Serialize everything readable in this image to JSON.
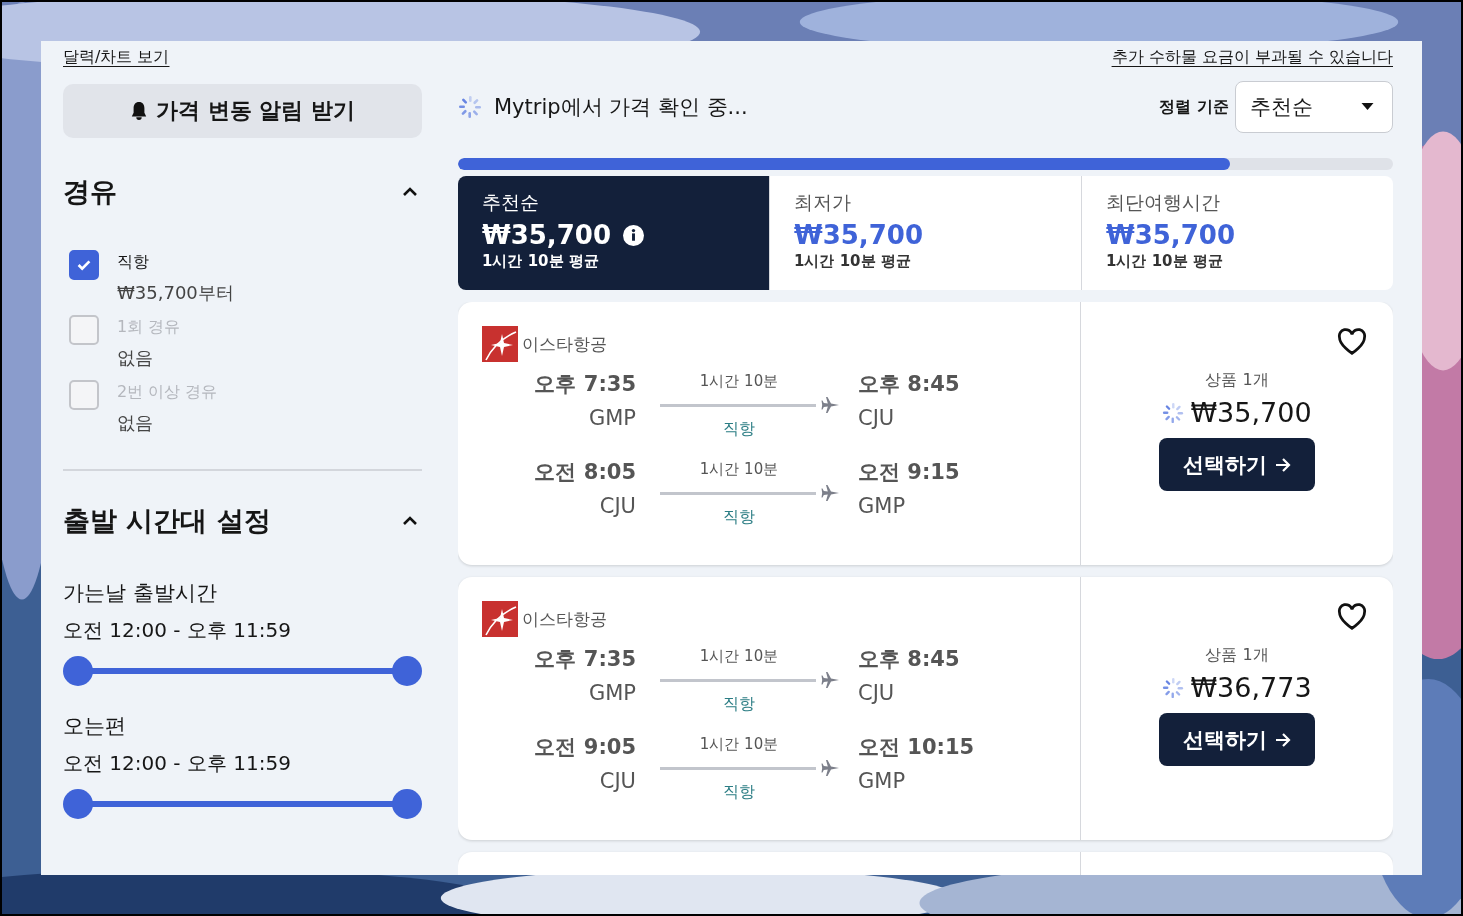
{
  "sidebar": {
    "calendar_link": "달력/차트 보기",
    "alert_button": "가격 변동 알림 받기",
    "stops": {
      "title": "경유",
      "expanded": true,
      "options": [
        {
          "label": "직항",
          "sub": "₩35,700부터",
          "checked": true,
          "disabled": false
        },
        {
          "label": "1회 경유",
          "sub": "없음",
          "checked": false,
          "disabled": true
        },
        {
          "label": "2번 이상 경유",
          "sub": "없음",
          "checked": false,
          "disabled": true
        }
      ]
    },
    "times": {
      "title": "출발 시간대 설정",
      "expanded": true,
      "ranges": [
        {
          "label": "가는날 출발시간",
          "value": "오전 12:00 - 오후 11:59",
          "thumbs": [
            {
              "level": 0
            },
            {
              "level": 1
            }
          ]
        },
        {
          "label": "오는편",
          "value": "오전 12:00 - 오후 11:59",
          "thumbs": [
            {
              "level": 0
            },
            {
              "level": 1
            }
          ]
        }
      ]
    }
  },
  "main": {
    "baggage_note": "추가 수하물 요금이 부과될 수 있습니다",
    "status": "Mytrip에서 가격 확인 중...",
    "sort": {
      "label": "정렬 기준",
      "value": "추천순"
    },
    "progress": {
      "level": 0.826
    },
    "sort_tabs": [
      {
        "label": "추천순",
        "price": "₩35,700",
        "duration": "1시간 10분 평균",
        "info": true,
        "selected": true
      },
      {
        "label": "최저가",
        "price": "₩35,700",
        "duration": "1시간 10분 평균",
        "info": false,
        "selected": false
      },
      {
        "label": "최단여행시간",
        "price": "₩35,700",
        "duration": "1시간 10분 평균",
        "info": false,
        "selected": false
      }
    ],
    "results": [
      {
        "airline": "이스타항공",
        "offers": "상품 1개",
        "price": "₩35,700",
        "button": "선택하기",
        "favorite": false,
        "legs": [
          {
            "dep_time": "오후 7:35",
            "dep": "GMP",
            "duration": "1시간 10분",
            "stops": "직항",
            "arr_time": "오후 8:45",
            "arr": "CJU"
          },
          {
            "dep_time": "오전 8:05",
            "dep": "CJU",
            "duration": "1시간 10분",
            "stops": "직항",
            "arr_time": "오전 9:15",
            "arr": "GMP"
          }
        ]
      },
      {
        "airline": "이스타항공",
        "offers": "상품 1개",
        "price": "₩36,773",
        "button": "선택하기",
        "favorite": false,
        "legs": [
          {
            "dep_time": "오후 7:35",
            "dep": "GMP",
            "duration": "1시간 10분",
            "stops": "직항",
            "arr_time": "오후 8:45",
            "arr": "CJU"
          },
          {
            "dep_time": "오전 9:05",
            "dep": "CJU",
            "duration": "1시간 10분",
            "stops": "직항",
            "arr_time": "오전 10:15",
            "arr": "GMP"
          }
        ]
      }
    ]
  }
}
